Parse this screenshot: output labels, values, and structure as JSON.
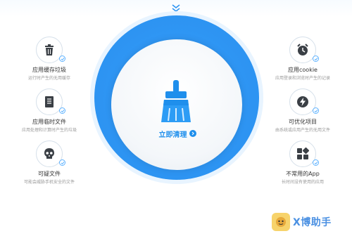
{
  "top": {
    "collapse_icon": "double-chevron-down-icon"
  },
  "main": {
    "clean_button_label": "立即清理",
    "brush_icon": "brush-icon"
  },
  "left_items": [
    {
      "title": "应用缓存垃圾",
      "desc": "运行时产生的无用缓存",
      "icon": "trash-icon"
    },
    {
      "title": "应用临时文件",
      "desc": "应用处理和计算时产生的垃圾",
      "icon": "document-icon"
    },
    {
      "title": "可疑文件",
      "desc": "可能会威胁手机安全的文件",
      "icon": "skull-icon"
    }
  ],
  "right_items": [
    {
      "title": "应用cookie",
      "desc": "应用登录和浏览时产生的记录",
      "icon": "clock-icon"
    },
    {
      "title": "可优化项目",
      "desc": "由系统或应用产生的无用文件",
      "icon": "lightning-icon"
    },
    {
      "title": "不常用的App",
      "desc": "长时间没有使用的应用",
      "icon": "apps-grid-icon"
    }
  ],
  "brand": {
    "text": "X博助手",
    "mascot_icon": "mascot-icon"
  },
  "colors": {
    "accent": "#2e95f3",
    "accent_dark": "#1f8fec",
    "text": "#333333",
    "muted": "#999999"
  }
}
